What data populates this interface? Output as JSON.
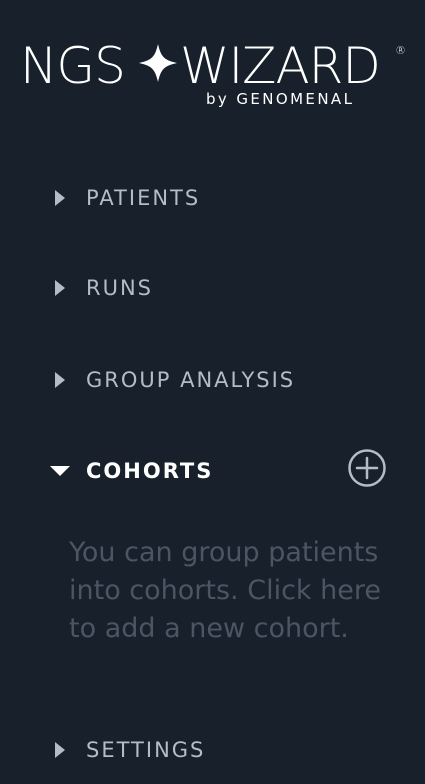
{
  "brand": {
    "logo_left": "NGS",
    "logo_right": "WIZARD",
    "registered_mark": "®",
    "byline": "by GENOMENAL",
    "star_icon": "four-point-star-icon"
  },
  "nav": {
    "patients": "PATIENTS",
    "runs": "RUNS",
    "group_analysis": "GROUP ANALYSIS",
    "cohorts": "COHORTS",
    "settings": "SETTINGS"
  },
  "cohorts": {
    "expanded": true,
    "add_icon": "plus-circle-icon",
    "empty_hint": "You can group patients into cohorts. Click here to add a new cohort."
  },
  "colors": {
    "background": "#17202b",
    "nav_text": "#b3bcc8",
    "active_text": "#ffffff",
    "hint_text": "#4b5563"
  }
}
